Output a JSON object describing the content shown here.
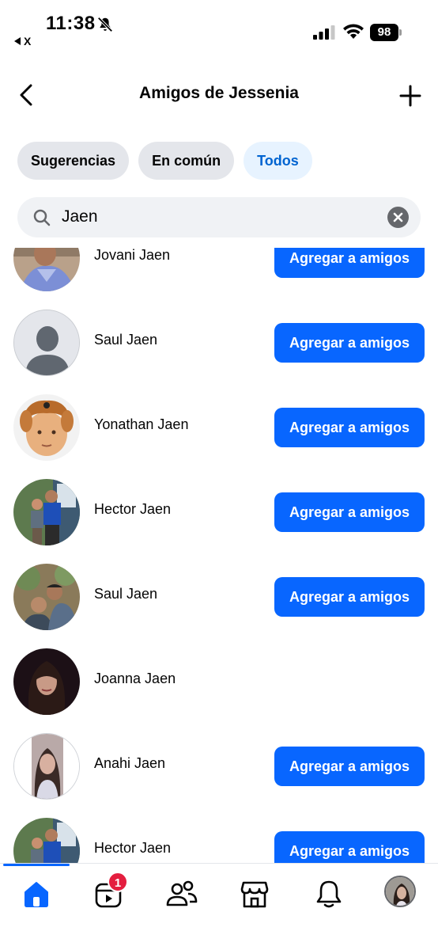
{
  "status_bar": {
    "time": "11:38",
    "back_app_label": "X",
    "battery": "98"
  },
  "header": {
    "title": "Amigos de Jessenia"
  },
  "filters": {
    "chips": [
      "Sugerencias",
      "En común",
      "Todos"
    ],
    "active": "Todos"
  },
  "search": {
    "value": "Jaen"
  },
  "people": [
    {
      "name": "Jovani Jaen",
      "button": "Agregar a amigos",
      "avatar": "photo-man-blue-shirt"
    },
    {
      "name": "Saul Jaen",
      "button": "Agregar a amigos",
      "avatar": "default-silhouette"
    },
    {
      "name": "Yonathan Jaen",
      "button": "Agregar a amigos",
      "avatar": "photo-child-dog-filter"
    },
    {
      "name": "Hector Jaen",
      "button": "Agregar a amigos",
      "avatar": "photo-two-boys"
    },
    {
      "name": "Saul Jaen",
      "button": "Agregar a amigos",
      "avatar": "photo-two-men-outdoors"
    },
    {
      "name": "Joanna Jaen",
      "button": "",
      "avatar": "photo-woman-dark-hair"
    },
    {
      "name": "Anahi Jaen",
      "button": "Agregar a amigos",
      "avatar": "photo-woman-mirror"
    },
    {
      "name": "Hector Jaen",
      "button": "Agregar a amigos",
      "avatar": "photo-two-boys"
    }
  ],
  "bottom_nav": {
    "items": [
      "home-icon",
      "video-icon",
      "friends-icon",
      "marketplace-icon",
      "notifications-icon",
      "profile-avatar"
    ],
    "active": "home-icon",
    "video_badge": "1"
  },
  "colors": {
    "accent": "#0866ff",
    "chip_bg": "#e4e6eb",
    "chip_active_bg": "#e7f3ff",
    "chip_active_text": "#0064d1",
    "badge": "#e41e3f"
  }
}
